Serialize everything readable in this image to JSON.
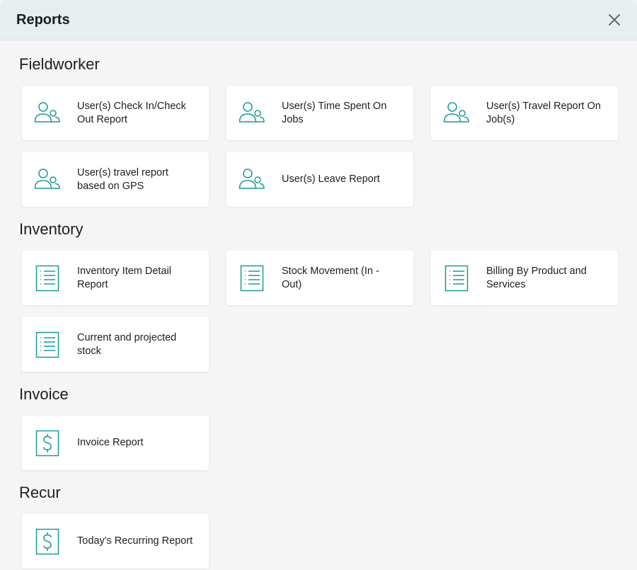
{
  "modal": {
    "title": "Reports"
  },
  "colors": {
    "accent": "#1a9a96",
    "header_bg": "#e6eef0",
    "page_bg": "#f5f5f5"
  },
  "sections": [
    {
      "title": "Fieldworker",
      "items": [
        {
          "label": "User(s) Check In/Check Out Report",
          "icon": "users-icon"
        },
        {
          "label": "User(s) Time Spent On Jobs",
          "icon": "users-icon"
        },
        {
          "label": "User(s) Travel Report On Job(s)",
          "icon": "users-icon"
        },
        {
          "label": "User(s) travel report based on GPS",
          "icon": "users-icon"
        },
        {
          "label": "User(s) Leave Report",
          "icon": "users-icon"
        }
      ]
    },
    {
      "title": "Inventory",
      "items": [
        {
          "label": "Inventory Item Detail Report",
          "icon": "list-document-icon"
        },
        {
          "label": "Stock Movement (In - Out)",
          "icon": "list-document-icon"
        },
        {
          "label": "Billing By Product and Services",
          "icon": "list-document-icon"
        },
        {
          "label": "Current and projected stock",
          "icon": "list-document-icon"
        }
      ]
    },
    {
      "title": "Invoice",
      "items": [
        {
          "label": "Invoice Report",
          "icon": "dollar-document-icon"
        }
      ]
    },
    {
      "title": "Recur",
      "items": [
        {
          "label": "Today's Recurring Report",
          "icon": "dollar-document-icon"
        }
      ]
    }
  ]
}
